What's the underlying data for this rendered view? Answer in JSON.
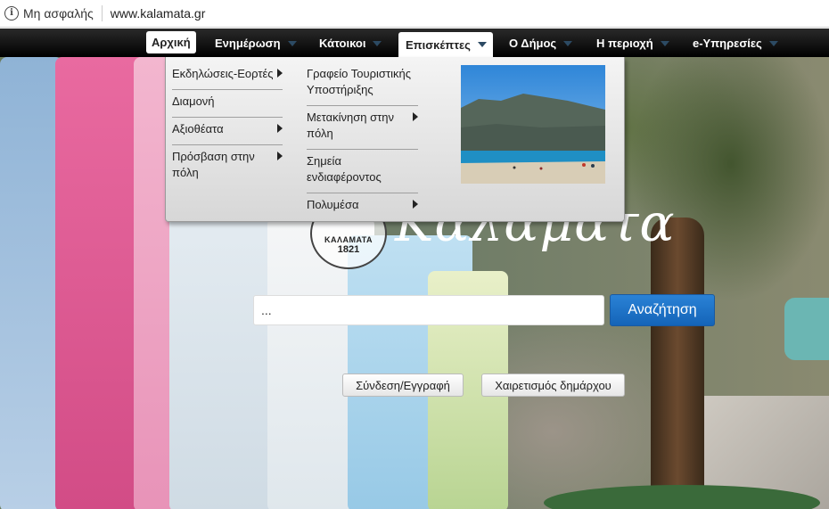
{
  "browser": {
    "security_label": "Μη ασφαλής",
    "url": "www.kalamata.gr"
  },
  "nav": {
    "items": [
      {
        "label": "Αρχική"
      },
      {
        "label": "Ενημέρωση"
      },
      {
        "label": "Κάτοικοι"
      },
      {
        "label": "Επισκέπτες"
      },
      {
        "label": "Ο Δήμος"
      },
      {
        "label": "Η περιοχή"
      },
      {
        "label": "e-Υπηρεσίες"
      }
    ]
  },
  "dropdown": {
    "col1": [
      {
        "label": "Εκδηλώσεις-Εορτές"
      },
      {
        "label": "Διαμονή"
      },
      {
        "label": "Αξιοθέατα"
      },
      {
        "label": "Πρόσβαση στην πόλη"
      }
    ],
    "col2": [
      {
        "label": "Γραφείο Τουριστικής Υποστήριξης"
      },
      {
        "label": "Μετακίνηση στην πόλη"
      },
      {
        "label": "Σημεία ενδιαφέροντος"
      },
      {
        "label": "Πολυμέσα"
      }
    ]
  },
  "logo": {
    "seal_name": "ΚΑΛΑΜΑΤΑ",
    "seal_year": "1821",
    "title": "Καλαμάτα"
  },
  "search": {
    "value": "...",
    "button_label": "Αναζήτηση"
  },
  "actions": {
    "login_label": "Σύνδεση/Εγγραφή",
    "mayor_label": "Χαιρετισμός δημάρχου"
  },
  "colors": {
    "accent": "#1b6fc6",
    "nav_bg": "#000000"
  }
}
